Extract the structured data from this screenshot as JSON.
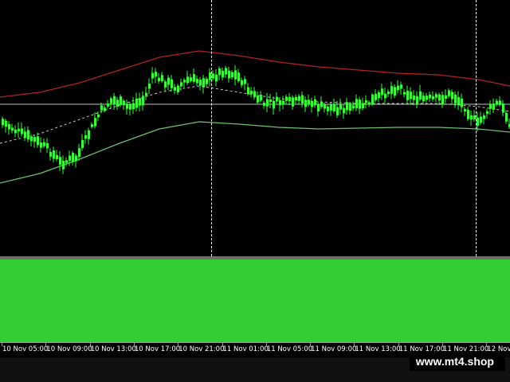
{
  "chart": {
    "time_labels": [
      "10 Nov 05:00",
      "10 Nov 09:00",
      "10 Nov 13:00",
      "10 Nov 17:00",
      "10 Nov 21:00",
      "11 Nov 01:00",
      "11 Nov 05:00",
      "11 Nov 09:00",
      "11 Nov 13:00",
      "11 Nov 17:00",
      "11 Nov 21:00",
      "12 Nov 0"
    ],
    "colors": {
      "background": "#000000",
      "candle": "#33ff33",
      "upper_band": "#b22222",
      "lower_band": "#6fbf6f",
      "middle_line": "#c8c8c8",
      "horizontal_line": "#c0c0c0",
      "indicator_fill": "#33cc33"
    }
  },
  "watermark": {
    "text": "www.mt4.shop"
  }
}
